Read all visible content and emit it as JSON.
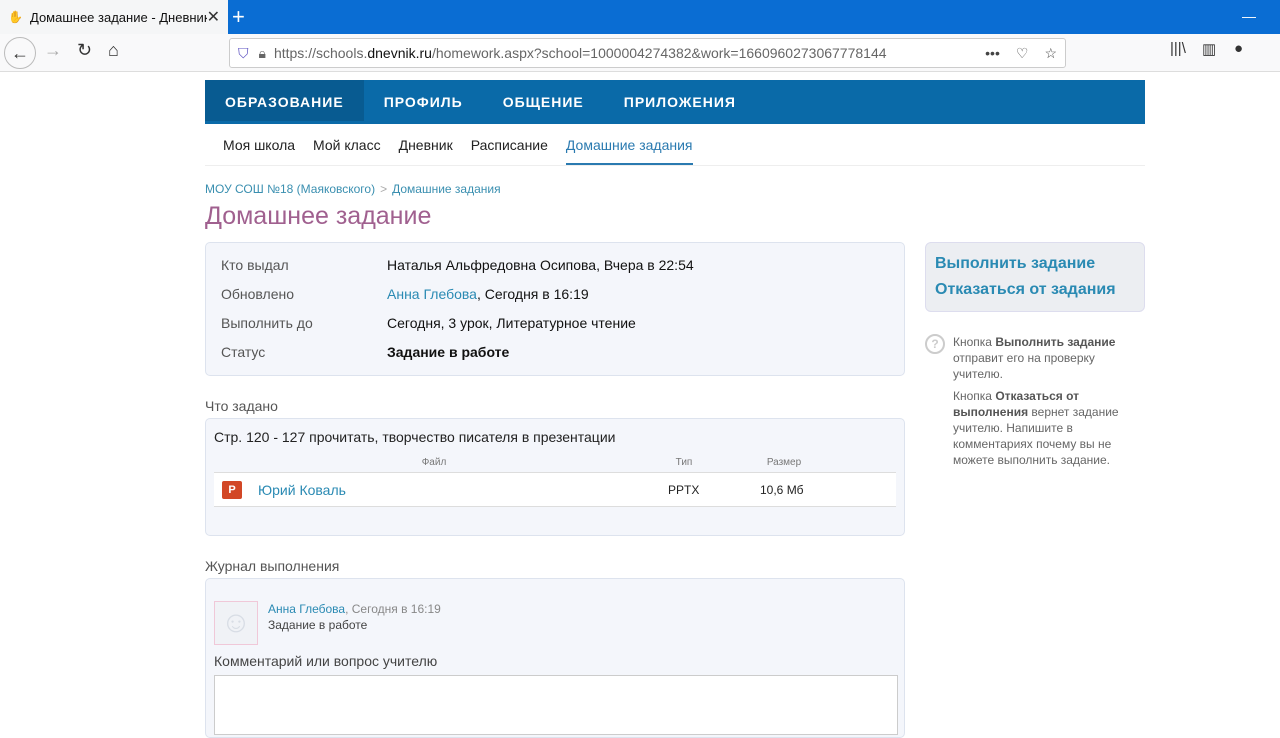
{
  "browser": {
    "tab_title": "Домашнее задание - Дневник",
    "url_prefix": "https://schools.",
    "url_domain": "dnevnik.ru",
    "url_rest": "/homework.aspx?school=1000004274382&work=1660960273067778144"
  },
  "nav": {
    "top": [
      "ОБРАЗОВАНИЕ",
      "ПРОФИЛЬ",
      "ОБЩЕНИЕ",
      "ПРИЛОЖЕНИЯ"
    ],
    "sub": [
      "Моя школа",
      "Мой класс",
      "Дневник",
      "Расписание",
      "Домашние задания"
    ]
  },
  "breadcrumb": {
    "school": "МОУ СОШ №18 (Маяковского)",
    "sep": ">",
    "current": "Домашние задания"
  },
  "title": "Домашнее задание",
  "info": {
    "issued_label": "Кто выдал",
    "issued_value": "Наталья Альфредовна Осипова, Вчера в 22:54",
    "updated_label": "Обновлено",
    "updated_user": "Анна Глебова",
    "updated_time": ", Сегодня в 16:19",
    "due_label": "Выполнить до",
    "due_value": "Сегодня, 3 урок, Литературное чтение",
    "status_label": "Статус",
    "status_value": "Задание в работе"
  },
  "task": {
    "heading": "Что задано",
    "text": "Стр. 120 - 127 прочитать, творчество писателя в презентации",
    "col_file": "Файл",
    "col_type": "Тип",
    "col_size": "Размер",
    "file": {
      "name": "Юрий Коваль",
      "type": "PPTX",
      "size": "10,6 Мб",
      "icon_letter": "P"
    }
  },
  "journal": {
    "heading": "Журнал выполнения",
    "user": "Анна Глебова",
    "time": ", Сегодня в 16:19",
    "status": "Задание в работе",
    "comment_label": "Комментарий или вопрос учителю"
  },
  "side": {
    "complete": "Выполнить задание",
    "decline": "Отказаться от задания",
    "help1_a": "Кнопка ",
    "help1_b": "Выполнить задание",
    "help1_c": " отправит его на проверку учителю.",
    "help2_a": "Кнопка ",
    "help2_b": "Отказаться от выполнения",
    "help2_c": " вернет задание учителю. Напишите в комментариях почему вы не можете выполнить задание."
  }
}
